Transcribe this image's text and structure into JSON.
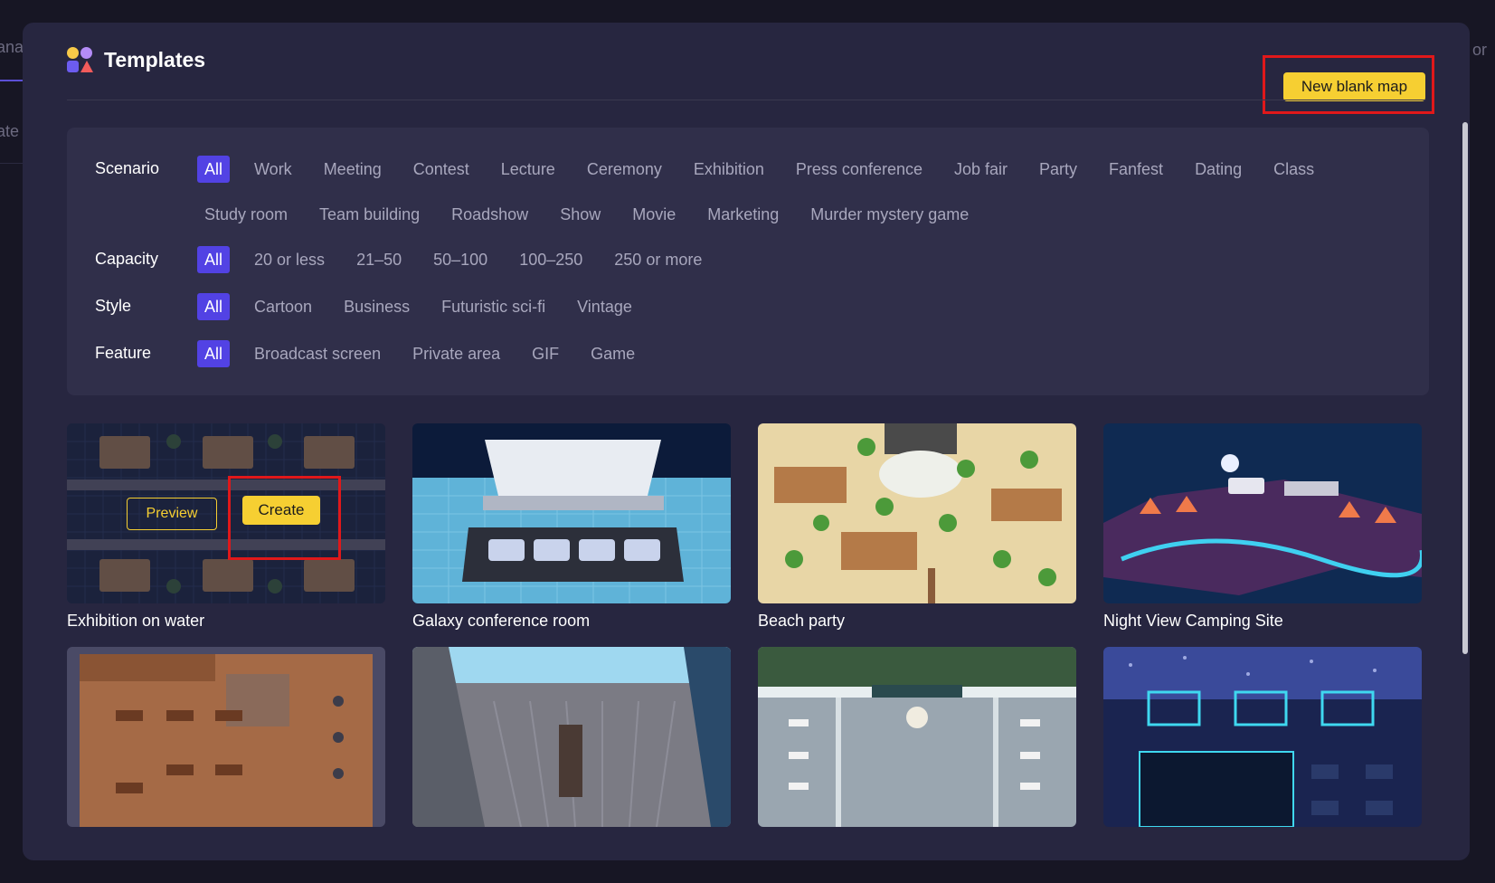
{
  "background": {
    "left_text_1": "ana",
    "left_text_2": "ate",
    "right_text": "or"
  },
  "header": {
    "title": "Templates",
    "new_blank_map_label": "New blank map",
    "close_icon": "close-icon"
  },
  "filters": [
    {
      "label": "Scenario",
      "options": [
        "All",
        "Work",
        "Meeting",
        "Contest",
        "Lecture",
        "Ceremony",
        "Exhibition",
        "Press conference",
        "Job fair",
        "Party",
        "Fanfest",
        "Dating",
        "Class",
        "Study room",
        "Team building",
        "Roadshow",
        "Show",
        "Movie",
        "Marketing",
        "Murder mystery game"
      ],
      "selected": "All"
    },
    {
      "label": "Capacity",
      "options": [
        "All",
        "20 or less",
        "21–50",
        "50–100",
        "100–250",
        "250 or more"
      ],
      "selected": "All"
    },
    {
      "label": "Style",
      "options": [
        "All",
        "Cartoon",
        "Business",
        "Futuristic sci-fi",
        "Vintage"
      ],
      "selected": "All"
    },
    {
      "label": "Feature",
      "options": [
        "All",
        "Broadcast screen",
        "Private area",
        "GIF",
        "Game"
      ],
      "selected": "All"
    }
  ],
  "templates": [
    {
      "name": "Exhibition on water"
    },
    {
      "name": "Galaxy conference room"
    },
    {
      "name": "Beach party"
    },
    {
      "name": "Night View Camping Site"
    },
    {
      "name": ""
    },
    {
      "name": ""
    },
    {
      "name": ""
    },
    {
      "name": ""
    }
  ],
  "hover_card": {
    "preview_label": "Preview",
    "create_label": "Create"
  },
  "colors": {
    "accent": "#5242e4",
    "button_yellow": "#f6cf32",
    "highlight_red": "#e0181a",
    "modal_bg": "#272640"
  }
}
